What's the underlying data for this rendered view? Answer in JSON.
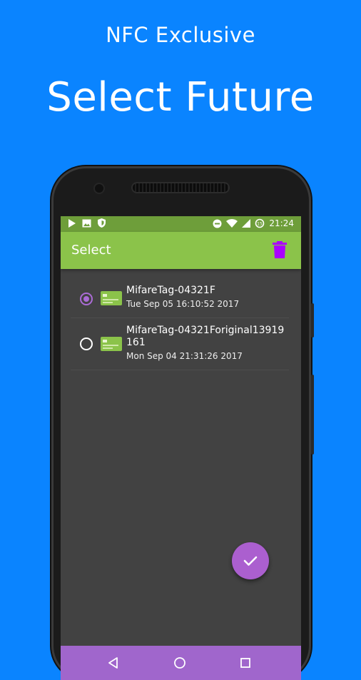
{
  "promo": {
    "subtitle": "NFC Exclusive",
    "title": "Select Future"
  },
  "status_bar": {
    "time": "21:24",
    "left_icons": [
      "play-icon",
      "image-icon",
      "shield-icon"
    ],
    "right_icons": [
      "do-not-disturb-icon",
      "wifi-icon",
      "signal-icon",
      "battery-saver-icon"
    ]
  },
  "app_bar": {
    "title": "Select",
    "action_icon": "delete-icon",
    "action_color": "#AA00FF"
  },
  "colors": {
    "background": "#0A84FF",
    "app_bar": "#8BC34A",
    "status_bar": "#6E9E3A",
    "accent": "#AB5FCF",
    "screen": "#424242"
  },
  "tags": [
    {
      "name": "MifareTag-04321F",
      "date": "Tue Sep 05 16:10:52 2017",
      "selected": true,
      "icon": "card-icon"
    },
    {
      "name": "MifareTag-04321Foriginal13919161",
      "date": "Mon Sep 04 21:31:26 2017",
      "selected": false,
      "icon": "card-icon"
    }
  ],
  "fab": {
    "icon": "check-icon"
  },
  "nav_bar": {
    "icons": [
      "back-icon",
      "home-icon",
      "recents-icon"
    ]
  }
}
